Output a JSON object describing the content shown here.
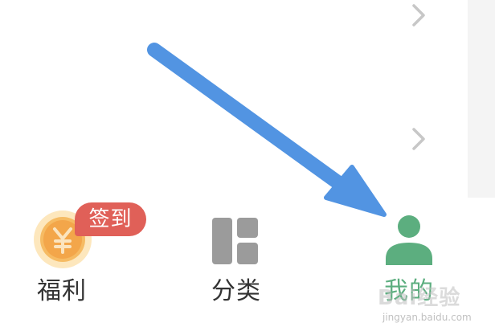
{
  "tabbar": {
    "tabs": [
      {
        "label": "福利",
        "icon": "coin-icon",
        "badge": "签到"
      },
      {
        "label": "分类",
        "icon": "category-grid-icon"
      },
      {
        "label": "我的",
        "icon": "profile-icon",
        "active": true
      }
    ]
  },
  "list": {
    "chevron_icon": "chevron-right-icon"
  },
  "annotation": {
    "arrow_icon": "arrow-icon",
    "arrow_color": "#5294e2"
  },
  "watermark": {
    "logo": "Bai经验",
    "url": "jingyan.baidu.com"
  },
  "colors": {
    "active_tab": "#5cae7f",
    "inactive_icon": "#9b9b9b",
    "badge_bg": "#e06058",
    "coin": "#f5b95f",
    "chevron": "#c7c7c7"
  }
}
